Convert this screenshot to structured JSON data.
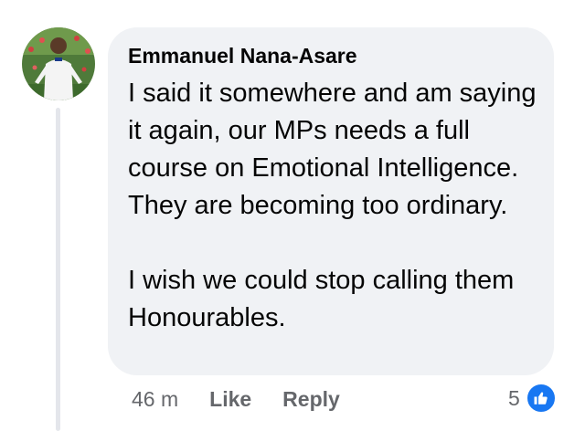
{
  "comment": {
    "author": "Emmanuel Nana-Asare",
    "paragraphs": [
      "I said it somewhere and am saying it again, our MPs needs a full course on Emotional Intelligence. They are becoming too ordinary.",
      "I wish we could stop calling them Honourables."
    ],
    "timestamp": "46 m",
    "like_label": "Like",
    "reply_label": "Reply",
    "reaction_count": "5",
    "reaction_icon": "like-icon"
  },
  "colors": {
    "bubble": "#f0f2f5",
    "text": "#050505",
    "meta": "#65676b",
    "like_blue": "#1877f2"
  }
}
